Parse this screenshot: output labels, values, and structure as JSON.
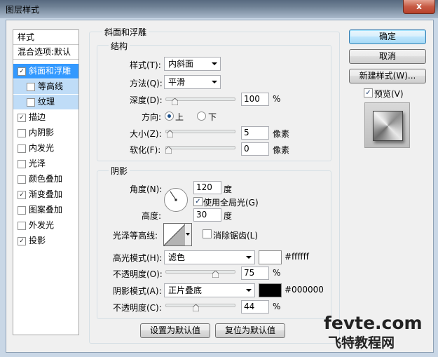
{
  "window": {
    "title": "图层样式",
    "close_label": "x"
  },
  "styles_panel": {
    "header": "样式",
    "blend_options": "混合选项:默认",
    "items": [
      {
        "label": "斜面和浮雕",
        "checked": true
      },
      {
        "label": "等高线",
        "checked": false
      },
      {
        "label": "纹理",
        "checked": false
      },
      {
        "label": "描边",
        "checked": true
      },
      {
        "label": "内阴影",
        "checked": false
      },
      {
        "label": "内发光",
        "checked": false
      },
      {
        "label": "光泽",
        "checked": false
      },
      {
        "label": "颜色叠加",
        "checked": false
      },
      {
        "label": "渐变叠加",
        "checked": true
      },
      {
        "label": "图案叠加",
        "checked": false
      },
      {
        "label": "外发光",
        "checked": false
      },
      {
        "label": "投影",
        "checked": true
      }
    ]
  },
  "bevel": {
    "group_title": "斜面和浮雕",
    "structure_title": "结构",
    "style_label": "样式(T):",
    "style_value": "内斜面",
    "technique_label": "方法(Q):",
    "technique_value": "平滑",
    "depth_label": "深度(D):",
    "depth_value": "100",
    "depth_unit": "%",
    "direction_label": "方向:",
    "dir_up": "上",
    "dir_down": "下",
    "size_label": "大小(Z):",
    "size_value": "5",
    "size_unit": "像素",
    "soften_label": "软化(F):",
    "soften_value": "0",
    "soften_unit": "像素",
    "sliders": {
      "depth": 0.1,
      "size": 0.02,
      "soften": 0.0
    }
  },
  "shading": {
    "group_title": "阴影",
    "angle_label": "角度(N):",
    "angle_value": "120",
    "angle_unit": "度",
    "global_light_label": "使用全局光(G)",
    "global_light_checked": true,
    "altitude_label": "高度:",
    "altitude_value": "30",
    "altitude_unit": "度",
    "gloss_label": "光泽等高线:",
    "antialias_label": "消除锯齿(L)",
    "antialias_checked": false,
    "highlight_label": "高光模式(H):",
    "highlight_mode": "滤色",
    "highlight_color": "#ffffff",
    "highlight_hex": "#ffffff",
    "highlight_opacity_label": "不透明度(O):",
    "highlight_opacity": "75",
    "highlight_opacity_unit": "%",
    "shadow_label": "阴影模式(A):",
    "shadow_mode": "正片叠底",
    "shadow_color": "#000000",
    "shadow_hex": "#000000",
    "shadow_opacity_label": "不透明度(C):",
    "shadow_opacity": "44",
    "shadow_opacity_unit": "%",
    "sliders": {
      "highlight_opacity": 0.75,
      "shadow_opacity": 0.44
    }
  },
  "bottom_buttons": {
    "make_default": "设置为默认值",
    "reset_default": "复位为默认值"
  },
  "right_buttons": {
    "ok": "确定",
    "cancel": "取消",
    "new_style": "新建样式(W)...",
    "preview_label": "预览(V)",
    "preview_checked": true
  },
  "watermark": {
    "line1": "fevte.com",
    "line2": "飞特教程网"
  },
  "colors": {
    "accent": "#3399ff",
    "titlebar": "#6e8094"
  }
}
